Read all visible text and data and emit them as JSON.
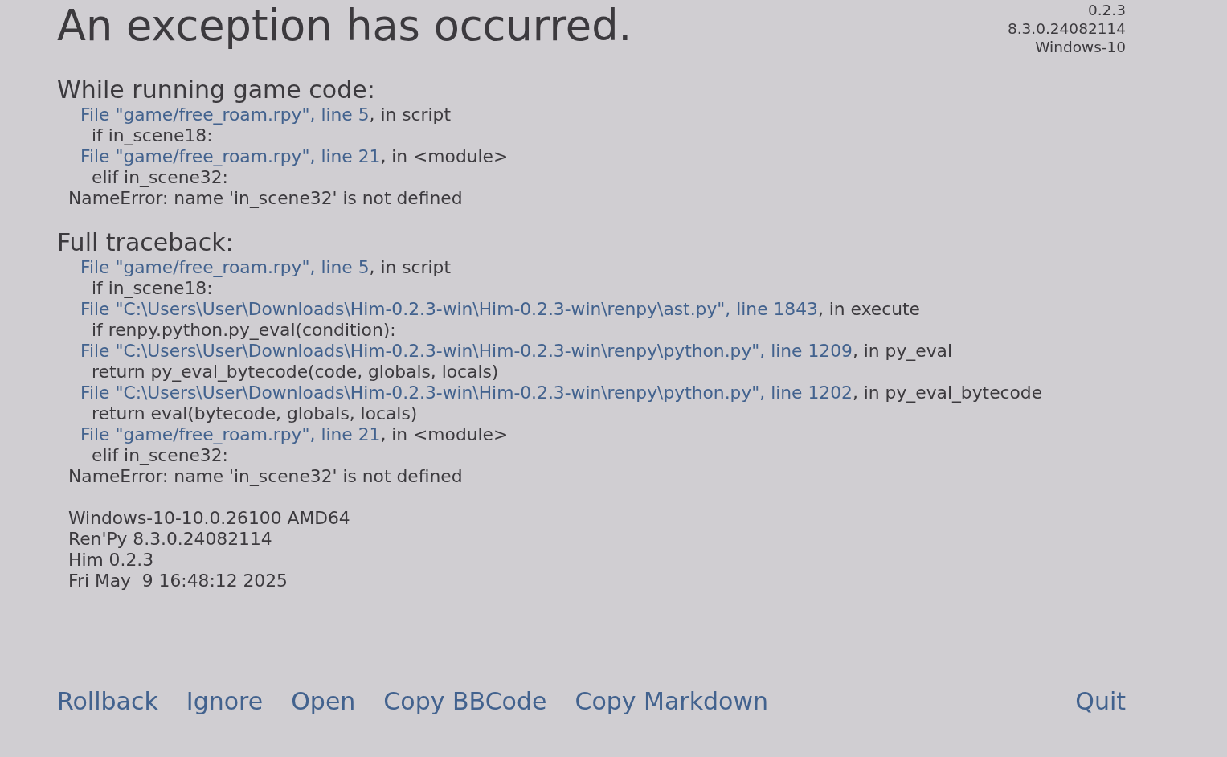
{
  "title": "An exception has occurred.",
  "version_info": [
    "0.2.3",
    "8.3.0.24082114",
    "Windows-10"
  ],
  "sections": [
    {
      "heading": "While running game code:",
      "lines": [
        {
          "kind": "file",
          "link": "File \"game/free_roam.rpy\", line 5",
          "rest": ", in script"
        },
        {
          "kind": "code",
          "text": "if in_scene18:"
        },
        {
          "kind": "file",
          "link": "File \"game/free_roam.rpy\", line 21",
          "rest": ", in <module>"
        },
        {
          "kind": "code",
          "text": "elif in_scene32:"
        },
        {
          "kind": "error",
          "text": "NameError: name 'in_scene32' is not defined"
        }
      ]
    },
    {
      "heading": "Full traceback:",
      "lines": [
        {
          "kind": "file",
          "link": "File \"game/free_roam.rpy\", line 5",
          "rest": ", in script"
        },
        {
          "kind": "code",
          "text": "if in_scene18:"
        },
        {
          "kind": "file",
          "link": "File \"C:\\Users\\User\\Downloads\\Him-0.2.3-win\\Him-0.2.3-win\\renpy\\ast.py\", line 1843",
          "rest": ", in execute"
        },
        {
          "kind": "code",
          "text": "if renpy.python.py_eval(condition):"
        },
        {
          "kind": "file",
          "link": "File \"C:\\Users\\User\\Downloads\\Him-0.2.3-win\\Him-0.2.3-win\\renpy\\python.py\", line 1209",
          "rest": ", in py_eval"
        },
        {
          "kind": "code",
          "text": "return py_eval_bytecode(code, globals, locals)"
        },
        {
          "kind": "file",
          "link": "File \"C:\\Users\\User\\Downloads\\Him-0.2.3-win\\Him-0.2.3-win\\renpy\\python.py\", line 1202",
          "rest": ", in py_eval_bytecode"
        },
        {
          "kind": "code",
          "text": "return eval(bytecode, globals, locals)"
        },
        {
          "kind": "file",
          "link": "File \"game/free_roam.rpy\", line 21",
          "rest": ", in <module>"
        },
        {
          "kind": "code",
          "text": "elif in_scene32:"
        },
        {
          "kind": "error",
          "text": "NameError: name 'in_scene32' is not defined"
        }
      ]
    }
  ],
  "system_info": [
    "Windows-10-10.0.26100 AMD64",
    "Ren'Py 8.3.0.24082114",
    "Him 0.2.3",
    "Fri May  9 16:48:12 2025"
  ],
  "buttons": [
    "Rollback",
    "Ignore",
    "Open",
    "Copy BBCode",
    "Copy Markdown"
  ],
  "quit_button": "Quit"
}
